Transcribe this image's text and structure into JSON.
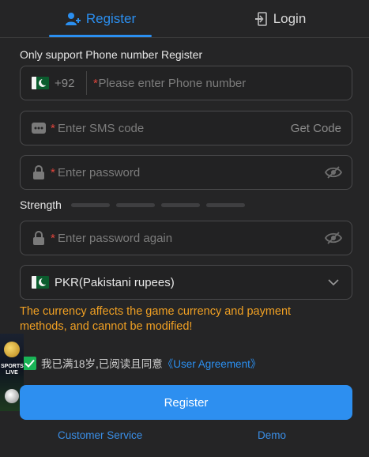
{
  "tabs": {
    "register": "Register",
    "login": "Login"
  },
  "form": {
    "support_note": "Only support Phone number Register",
    "phone": {
      "country_code": "+92",
      "required_mark": "*",
      "placeholder": "Please enter Phone number",
      "flag_icon": "pakistan-flag-icon"
    },
    "sms": {
      "required_mark": "*",
      "placeholder": "Enter SMS code",
      "action": "Get Code",
      "icon": "message-icon"
    },
    "password": {
      "required_mark": "*",
      "placeholder": "Enter password",
      "icon": "lock-icon",
      "toggle_icon": "eye-off-icon"
    },
    "strength": {
      "label": "Strength",
      "level": 0,
      "segments": 4
    },
    "password_again": {
      "required_mark": "*",
      "placeholder": "Enter password again",
      "icon": "lock-icon",
      "toggle_icon": "eye-off-icon"
    },
    "currency": {
      "selected": "PKR(Pakistani rupees)",
      "flag_icon": "pakistan-flag-icon"
    },
    "currency_notice": "The currency affects the game currency and payment methods, and cannot be modified!",
    "agreement": {
      "checked": true,
      "text": "我已满18岁,已阅读且同意",
      "link": "《User Agreement》"
    },
    "submit": "Register"
  },
  "footer": {
    "customer_service": "Customer Service",
    "demo": "Demo"
  },
  "promo": {
    "text": "SPORTS LIVE"
  },
  "colors": {
    "accent": "#2b8ff0",
    "warning": "#f0a023",
    "required": "#e0453c",
    "checkbox": "#19b456",
    "background": "#252526"
  }
}
